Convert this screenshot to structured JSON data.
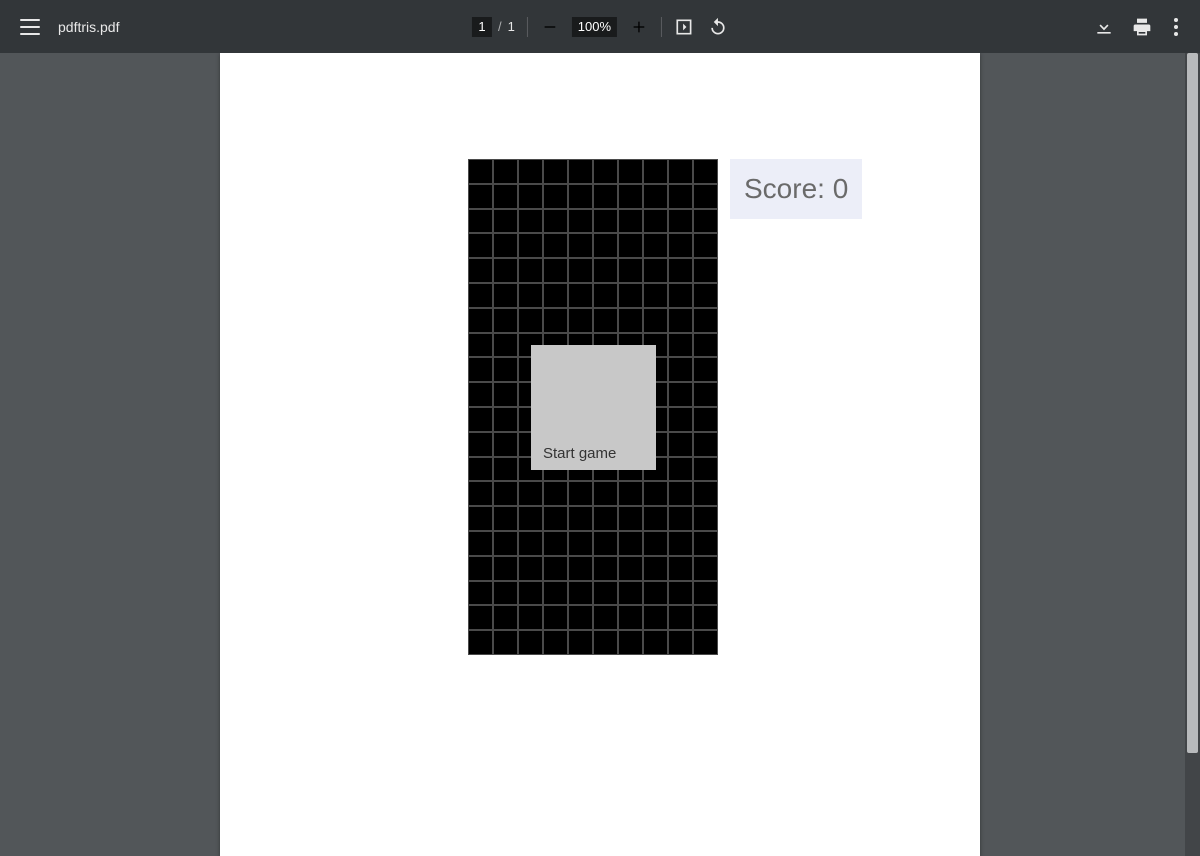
{
  "toolbar": {
    "filename": "pdftris.pdf",
    "page_current": "1",
    "page_separator": "/",
    "page_total": "1",
    "zoom_minus": "−",
    "zoom_level": "100%",
    "zoom_plus": "+"
  },
  "game": {
    "start_label": "Start game",
    "score_label": "Score: ",
    "score_value": "0",
    "grid_cols": 10,
    "grid_rows": 20
  }
}
